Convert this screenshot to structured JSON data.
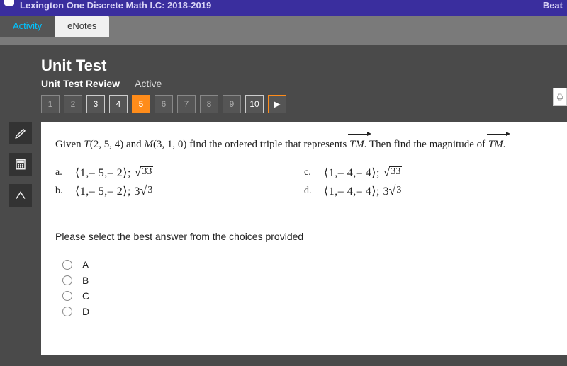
{
  "header": {
    "course_title": "Lexington One Discrete Math I.C: 2018-2019",
    "right_text": "Beat"
  },
  "tabs": {
    "activity": "Activity",
    "enotes": "eNotes"
  },
  "page": {
    "title": "Unit Test",
    "subtitle_bold": "Unit Test Review",
    "subtitle_status": "Active"
  },
  "nav": {
    "items": [
      "1",
      "2",
      "3",
      "4",
      "5",
      "6",
      "7",
      "8",
      "9",
      "10"
    ],
    "lit": [
      "3",
      "4",
      "10"
    ],
    "current": "5",
    "next_glyph": "▶"
  },
  "tools": {
    "pencil": "pencil-icon",
    "calculator": "calculator-icon",
    "pointer": "pointer-icon"
  },
  "question": {
    "prefix_given": "Given ",
    "point_T_label": "T",
    "point_T": "(2, 5, 4)",
    "and_word": " and ",
    "point_M_label": "M",
    "point_M": "(3, 1, 0)",
    "prompt_mid": " find the ordered triple that represents ",
    "vector_name": "TM",
    "prompt_tail": ". Then find the magnitude of ",
    "period": ".",
    "choices": {
      "a": {
        "label": "a.",
        "tuple": "⟨1,– 5,– 2⟩; ",
        "rad_pre": "",
        "radicand": "33"
      },
      "b": {
        "label": "b.",
        "tuple": "⟨1,– 5,– 2⟩; ",
        "rad_pre": "3",
        "radicand": "3"
      },
      "c": {
        "label": "c.",
        "tuple": "⟨1,– 4,– 4⟩; ",
        "rad_pre": "",
        "radicand": "33"
      },
      "d": {
        "label": "d.",
        "tuple": "⟨1,– 4,– 4⟩; ",
        "rad_pre": "3",
        "radicand": "3"
      }
    },
    "instruction": "Please select the best answer from the choices provided",
    "answers": [
      "A",
      "B",
      "C",
      "D"
    ]
  },
  "icons": {
    "print": "print-icon"
  }
}
